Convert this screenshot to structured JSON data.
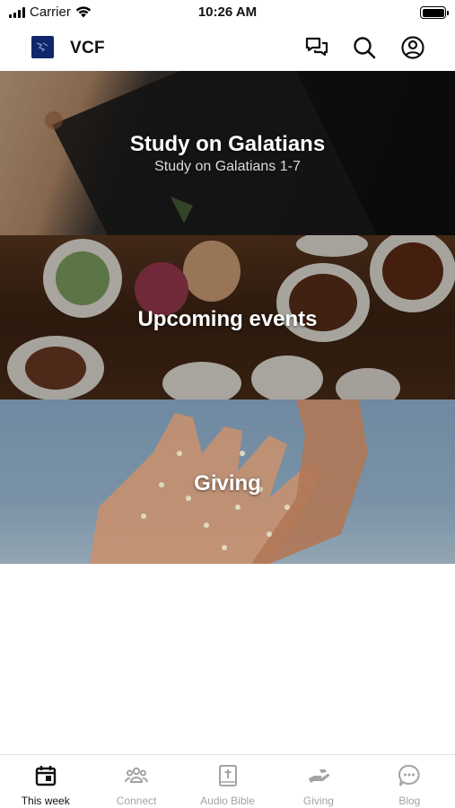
{
  "status_bar": {
    "carrier": "Carrier",
    "time": "10:26 AM"
  },
  "header": {
    "app_name": "VCF",
    "icons": [
      "logo-icon",
      "chat-icon",
      "search-icon",
      "profile-icon"
    ]
  },
  "cards": [
    {
      "title": "Study on Galatians",
      "subtitle": "Study on Galatians 1-7"
    },
    {
      "title": "Upcoming events"
    },
    {
      "title": "Giving"
    }
  ],
  "tabs": [
    {
      "label": "This week",
      "icon": "calendar-icon",
      "active": true
    },
    {
      "label": "Connect",
      "icon": "people-icon",
      "active": false
    },
    {
      "label": "Audio Bible",
      "icon": "bible-icon",
      "active": false
    },
    {
      "label": "Giving",
      "icon": "giving-hand-icon",
      "active": false
    },
    {
      "label": "Blog",
      "icon": "blog-chat-icon",
      "active": false
    }
  ],
  "colors": {
    "accent": "#111111",
    "inactive": "#a3a3a3",
    "logo_bg": "#10286b"
  }
}
